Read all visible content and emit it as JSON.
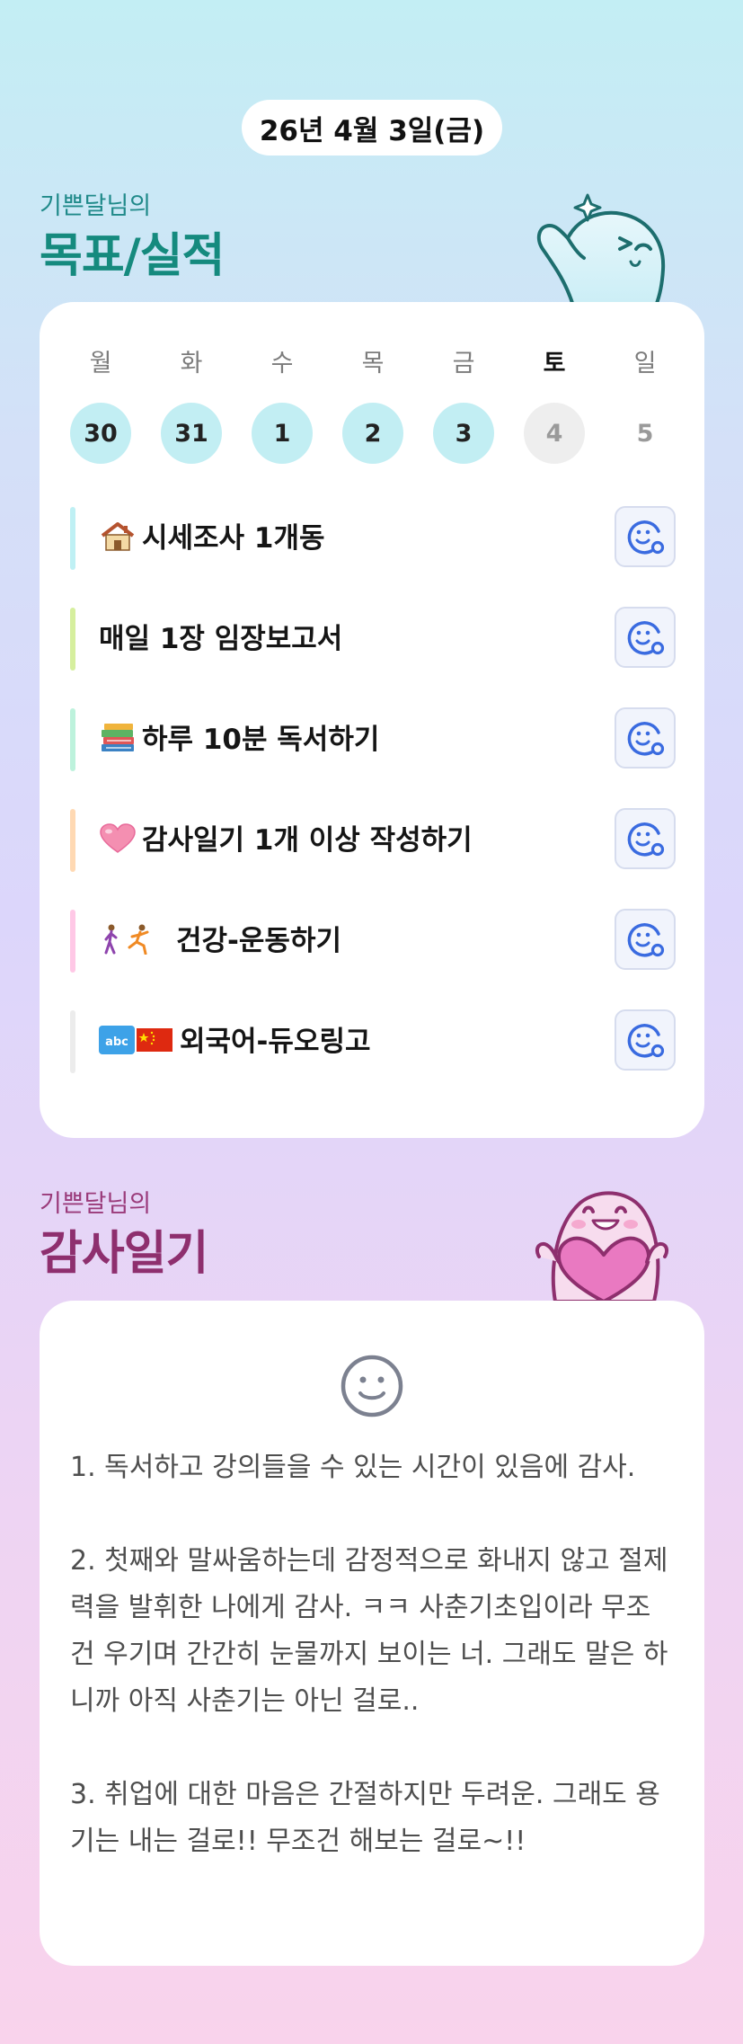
{
  "header": {
    "date": "26년 4월 3일(금)"
  },
  "goals_section": {
    "subtitle": "기쁜달님의",
    "title": "목표/실적",
    "weekdays": [
      "월",
      "화",
      "수",
      "목",
      "금",
      "토",
      "일"
    ],
    "dates": [
      "30",
      "31",
      "1",
      "2",
      "3",
      "4",
      "5"
    ],
    "goals": [
      {
        "emoji": "house-icon",
        "label": "시세조사 1개동",
        "accent": "#bff0f4"
      },
      {
        "emoji": "",
        "label": "매일 1장 임장보고서",
        "accent": "#d6ef9e"
      },
      {
        "emoji": "books-icon",
        "label": "하루 10분 독서하기",
        "accent": "#bdf2dc"
      },
      {
        "emoji": "pink-heart-icon",
        "label": "감사일기 1개 이상 작성하기",
        "accent": "#ffd9b3"
      },
      {
        "emoji": "walking-running-icon",
        "label": "건강-운동하기",
        "accent": "#ffc8e6"
      },
      {
        "emoji": "abc-china-flag-icon",
        "label": "외국어-듀오링고",
        "accent": "#ececec"
      }
    ]
  },
  "diary_section": {
    "subtitle": "기쁜달님의",
    "title": "감사일기",
    "entries": [
      "1. 독서하고 강의들을 수 있는 시간이 있음에 감사.",
      "2. 첫째와 말싸움하는데 감정적으로 화내지 않고 절제력을 발휘한 나에게 감사. ㅋㅋ 사춘기초입이라 무조건 우기며 간간히 눈물까지 보이는 너.  그래도 말은 하니까 아직 사춘기는 아닌 걸로..",
      "3. 취업에 대한 마음은 간절하지만 두려운. 그래도 용기는 내는 걸로!! 무조건 해보는 걸로~!!"
    ]
  },
  "colors": {
    "goal_title": "#158a7e",
    "diary_title": "#8e2f6e",
    "date_done_bg": "#c2eef3",
    "button_icon": "#3a6be0"
  }
}
